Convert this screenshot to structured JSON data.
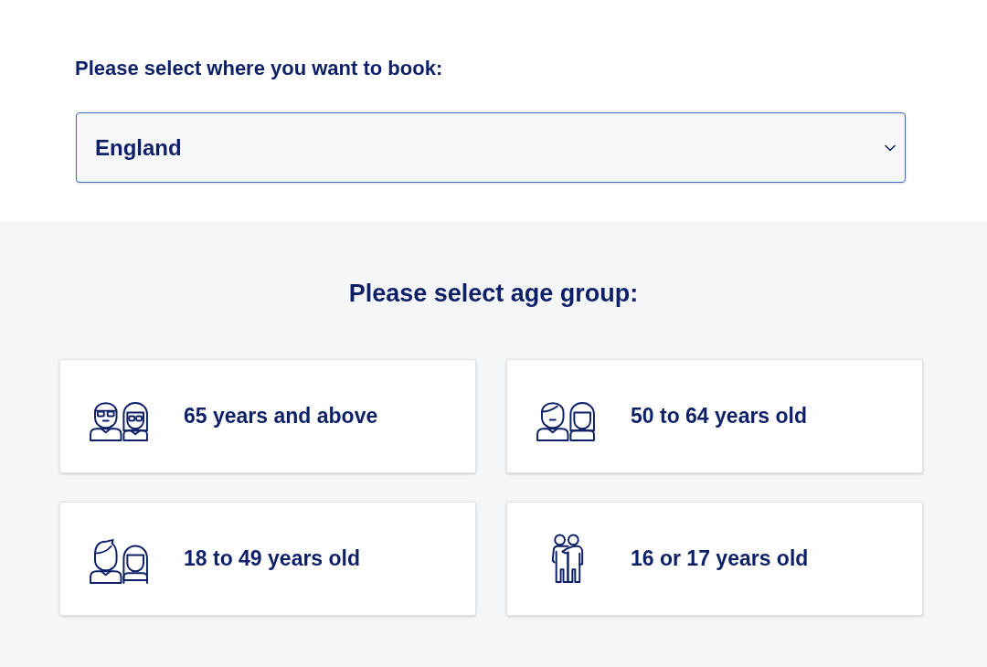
{
  "location": {
    "label": "Please select where you want to book:",
    "select": {
      "value": "England"
    }
  },
  "age_section": {
    "heading": "Please select age group:",
    "groups": [
      {
        "label": "65 years and above",
        "kind": "glasses"
      },
      {
        "label": "50 to 64 years old",
        "kind": "adults"
      },
      {
        "label": "18 to 49 years old",
        "kind": "young"
      },
      {
        "label": "16 or 17 years old",
        "kind": "teens"
      }
    ]
  }
}
